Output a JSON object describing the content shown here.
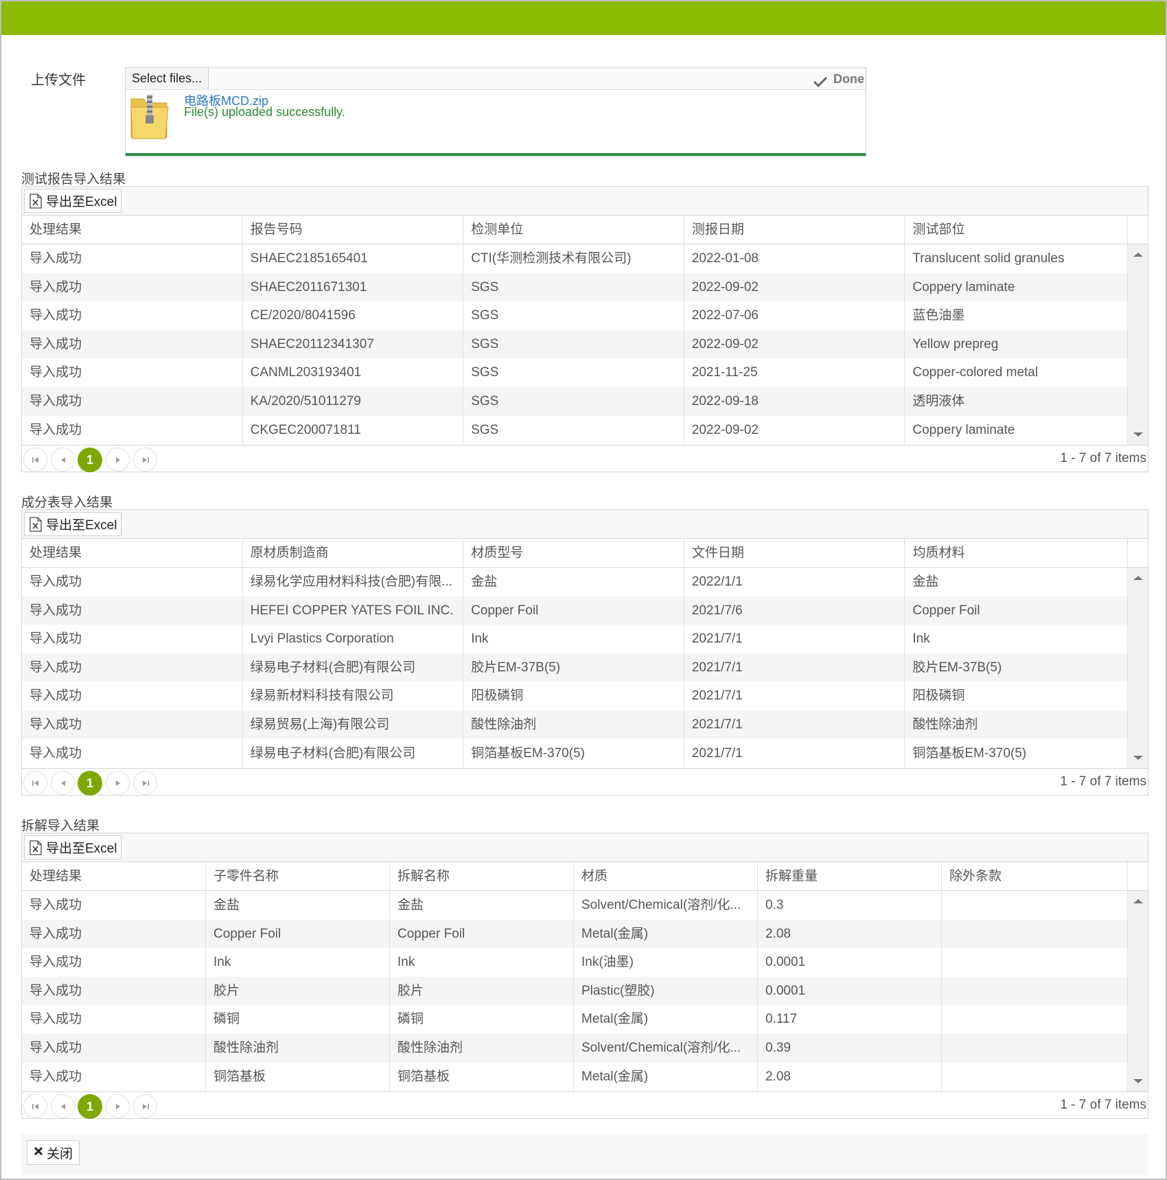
{
  "upload": {
    "label": "上传文件",
    "select_label": "Select files...",
    "done_label": "Done",
    "file_name": "电路板MCD.zip",
    "status": "File(s) uploaded successfully."
  },
  "export_label": "导出至Excel",
  "close_label": "关闭",
  "sections": [
    {
      "title": "测试报告导入结果",
      "columns": [
        "处理结果",
        "报告号码",
        "检测单位",
        "测报日期",
        "测试部位"
      ],
      "rows": [
        [
          "导入成功",
          "SHAEC2185165401",
          "CTI(华测检测技术有限公司)",
          "2022-01-08",
          "Translucent solid granules"
        ],
        [
          "导入成功",
          "SHAEC2011671301",
          "SGS",
          "2022-09-02",
          "Coppery laminate"
        ],
        [
          "导入成功",
          "CE/2020/8041596",
          "SGS",
          "2022-07-06",
          "蓝色油墨"
        ],
        [
          "导入成功",
          "SHAEC20112341307",
          "SGS",
          "2022-09-02",
          "Yellow prepreg"
        ],
        [
          "导入成功",
          "CANML203193401",
          "SGS",
          "2021-11-25",
          "Copper-colored metal"
        ],
        [
          "导入成功",
          "KA/2020/51011279",
          "SGS",
          "2022-09-18",
          "透明液体"
        ],
        [
          "导入成功",
          "CKGEC200071811",
          "SGS",
          "2022-09-02",
          "Coppery laminate"
        ]
      ],
      "page": "1",
      "page_info": "1 - 7 of 7 items"
    },
    {
      "title": "成分表导入结果",
      "columns": [
        "处理结果",
        "原材质制造商",
        "材质型号",
        "文件日期",
        "均质材料"
      ],
      "rows": [
        [
          "导入成功",
          "绿易化学应用材料科技(合肥)有限...",
          "金盐",
          "2022/1/1",
          "金盐"
        ],
        [
          "导入成功",
          "HEFEI COPPER YATES FOIL INC.",
          "Copper Foil",
          "2021/7/6",
          "Copper Foil"
        ],
        [
          "导入成功",
          "Lvyi Plastics Corporation",
          "Ink",
          "2021/7/1",
          "Ink"
        ],
        [
          "导入成功",
          "绿易电子材料(合肥)有限公司",
          "胶片EM-37B(5)",
          "2021/7/1",
          "胶片EM-37B(5)"
        ],
        [
          "导入成功",
          "绿易新材料科技有限公司",
          "阳极磷铜",
          "2021/7/1",
          "阳极磷铜"
        ],
        [
          "导入成功",
          "绿易贸易(上海)有限公司",
          "酸性除油剂",
          "2021/7/1",
          "酸性除油剂"
        ],
        [
          "导入成功",
          "绿易电子材料(合肥)有限公司",
          "铜箔基板EM-370(5)",
          "2021/7/1",
          "铜箔基板EM-370(5)"
        ]
      ],
      "page": "1",
      "page_info": "1 - 7 of 7 items"
    },
    {
      "title": "拆解导入结果",
      "columns": [
        "处理结果",
        "子零件名称",
        "拆解名称",
        "材质",
        "拆解重量",
        "除外条款"
      ],
      "rows": [
        [
          "导入成功",
          "金盐",
          "金盐",
          "Solvent/Chemical(溶剂/化...",
          "0.3",
          ""
        ],
        [
          "导入成功",
          "Copper Foil",
          "Copper Foil",
          "Metal(金属)",
          "2.08",
          ""
        ],
        [
          "导入成功",
          "Ink",
          "Ink",
          "Ink(油墨)",
          "0.0001",
          ""
        ],
        [
          "导入成功",
          "胶片",
          "胶片",
          "Plastic(塑胶)",
          "0.0001",
          ""
        ],
        [
          "导入成功",
          "磷铜",
          "磷铜",
          "Metal(金属)",
          "0.117",
          ""
        ],
        [
          "导入成功",
          "酸性除油剂",
          "酸性除油剂",
          "Solvent/Chemical(溶剂/化...",
          "0.39",
          ""
        ],
        [
          "导入成功",
          "铜箔基板",
          "铜箔基板",
          "Metal(金属)",
          "2.08",
          ""
        ]
      ],
      "page": "1",
      "page_info": "1 - 7 of 7 items"
    }
  ],
  "colors": {
    "accent": "#8cba00",
    "pager_active": "#7ea700",
    "success": "#2e8a2e",
    "link": "#2a79c4"
  }
}
